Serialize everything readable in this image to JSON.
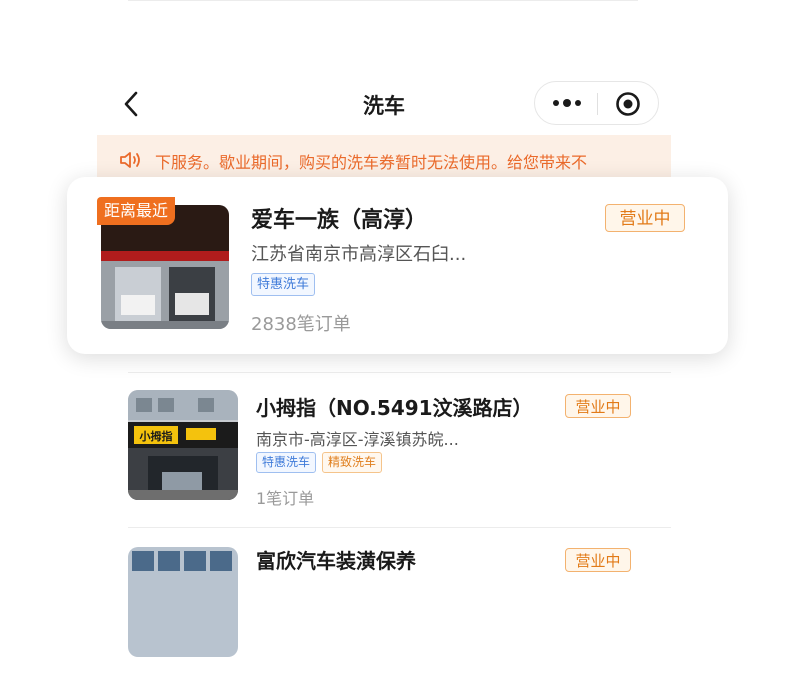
{
  "navbar": {
    "title": "洗车",
    "back_icon": "chevron-left-icon",
    "more_icon": "more-dots-icon",
    "close_icon": "target-circle-icon"
  },
  "notice": {
    "icon": "speaker-icon",
    "text": "下服务。歇业期间，购买的洗车券暂时无法使用。给您带来不"
  },
  "featured_shop": {
    "badge": "距离最近",
    "name": "爱车一族（高淳）",
    "address": "江苏省南京市高淳区石臼...",
    "tags": [
      "特惠洗车"
    ],
    "orders": "2838笔订单",
    "status": "营业中"
  },
  "shops": [
    {
      "name": "小拇指（NO.5491汶溪路店）",
      "address": "南京市-高淳区-淳溪镇苏皖...",
      "tags": [
        "特惠洗车",
        "精致洗车"
      ],
      "orders": "1笔订单",
      "status": "营业中",
      "sign_text": "小拇指"
    },
    {
      "name": "富欣汽车装潢保养",
      "status": "营业中"
    }
  ],
  "colors": {
    "accent_orange": "#ef6f1f",
    "notice_bg": "#fcefe5",
    "status_orange": "#e27a17",
    "tag_blue": "#3f7bd9"
  }
}
